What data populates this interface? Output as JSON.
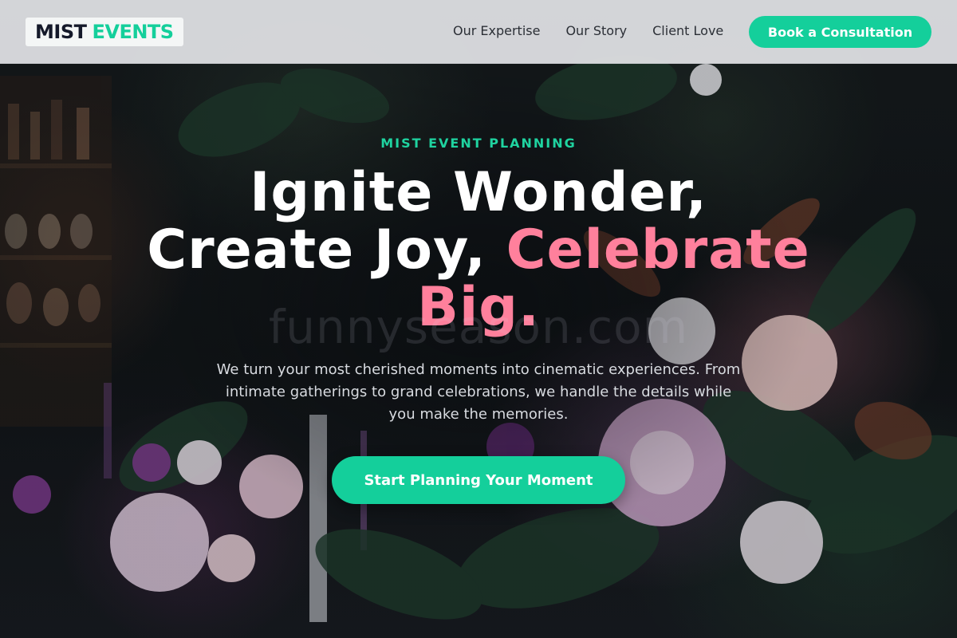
{
  "brand": {
    "logo_primary": "MIST",
    "logo_accent": "EVENTS",
    "accent_color": "#14cf9b",
    "highlight_color": "#ff809c"
  },
  "nav": {
    "links": [
      "Our Expertise",
      "Our Story",
      "Client Love"
    ],
    "cta_label": "Book a Consultation"
  },
  "hero": {
    "eyebrow": "MIST EVENT PLANNING",
    "headline_line1": "Ignite Wonder,",
    "headline_line2_plain": "Create Joy,",
    "headline_highlight": "Celebrate Big.",
    "watermark": "funnyseason.com",
    "subtext": "We turn your most cherished moments into cinematic experiences. From intimate gatherings to grand celebrations, we handle the details while you make the memories.",
    "cta_label": "Start Planning Your Moment"
  }
}
